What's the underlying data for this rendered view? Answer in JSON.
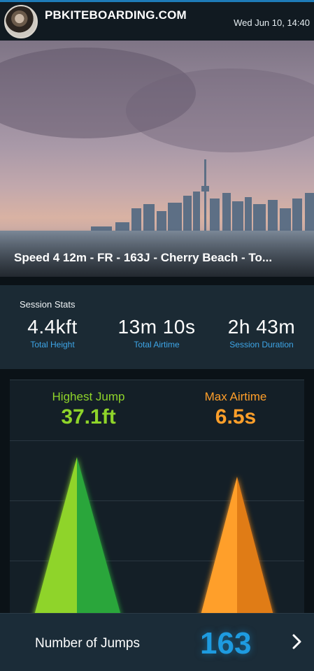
{
  "header": {
    "brand": "PBKITEBOARDING.COM",
    "datetime": "Wed Jun 10, 14:40"
  },
  "session": {
    "title": "Speed 4 12m - FR - 163J - Cherry Beach - To..."
  },
  "stats": {
    "title": "Session Stats",
    "items": [
      {
        "value": "4.4kft",
        "label": "Total Height"
      },
      {
        "value": "13m 10s",
        "label": "Total Airtime"
      },
      {
        "value": "2h 43m",
        "label": "Session Duration"
      }
    ]
  },
  "highlights": {
    "highest_jump": {
      "label": "Highest Jump",
      "value": "37.1ft"
    },
    "max_airtime": {
      "label": "Max Airtime",
      "value": "6.5s"
    }
  },
  "colors": {
    "accent_blue": "#1e9be0",
    "jump_green": "#8fd42a",
    "airtime_orange": "#ff9f2a"
  },
  "footer": {
    "jumps_label": "Number of Jumps",
    "jumps_value": "163"
  },
  "icons": [
    "avatar",
    "chevron-right-icon"
  ]
}
